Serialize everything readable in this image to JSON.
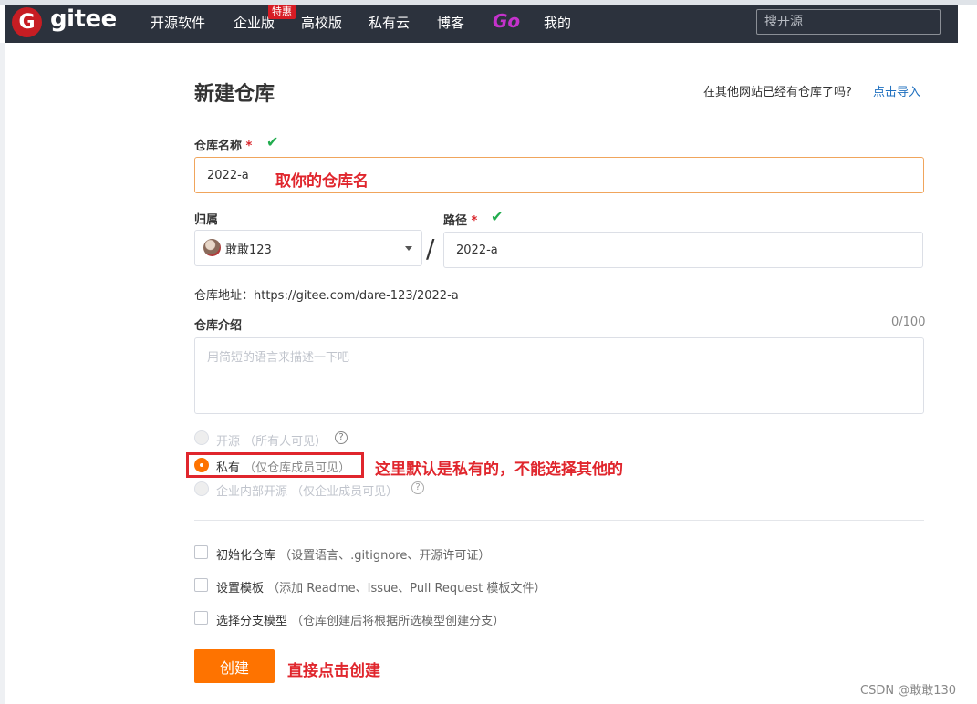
{
  "nav": {
    "logo_letter": "G",
    "logo_text": "gitee",
    "items": [
      "开源软件",
      "企业版",
      "高校版",
      "私有云",
      "博客"
    ],
    "go_label": "Go",
    "mine_label": "我的",
    "badge": "特惠",
    "search_placeholder": "搜开源"
  },
  "form": {
    "title": "新建仓库",
    "import_question": "在其他网站已经有仓库了吗?",
    "import_link": "点击导入",
    "name_label": "仓库名称",
    "required_mark": "*",
    "name_value": "2022-a",
    "owner_label": "归属",
    "owner_value": "敢敢123",
    "path_label": "路径",
    "path_value": "2022-a",
    "slash": "/",
    "url_line": "仓库地址：https://gitee.com/dare-123/2022-a",
    "desc_label": "仓库介绍",
    "desc_counter": "0/100",
    "desc_placeholder": "用简短的语言来描述一下吧",
    "visibility": {
      "public": {
        "label": "开源",
        "hint": "（所有人可见）"
      },
      "private": {
        "label": "私有",
        "hint": "（仅仓库成员可见）"
      },
      "internal": {
        "label": "企业内部开源",
        "hint": "（仅企业成员可见）"
      }
    },
    "options": [
      {
        "label": "初始化仓库",
        "hint": "（设置语言、.gitignore、开源许可证）"
      },
      {
        "label": "设置模板",
        "hint": "（添加 Readme、Issue、Pull Request 模板文件）"
      },
      {
        "label": "选择分支模型",
        "hint": "（仓库创建后将根据所选模型创建分支）"
      }
    ],
    "create_button": "创建"
  },
  "annotations": {
    "name": "取你的仓库名",
    "private": "这里默认是私有的，不能选择其他的",
    "create": "直接点击创建"
  },
  "watermark": "CSDN @敢敢130",
  "colors": {
    "navbar": "#2c323d",
    "brand_red": "#c71d23",
    "accent_orange": "#fe7300",
    "link_blue": "#1e6fbf",
    "annotation_red": "#e0262d",
    "check_green": "#21ac4e"
  }
}
